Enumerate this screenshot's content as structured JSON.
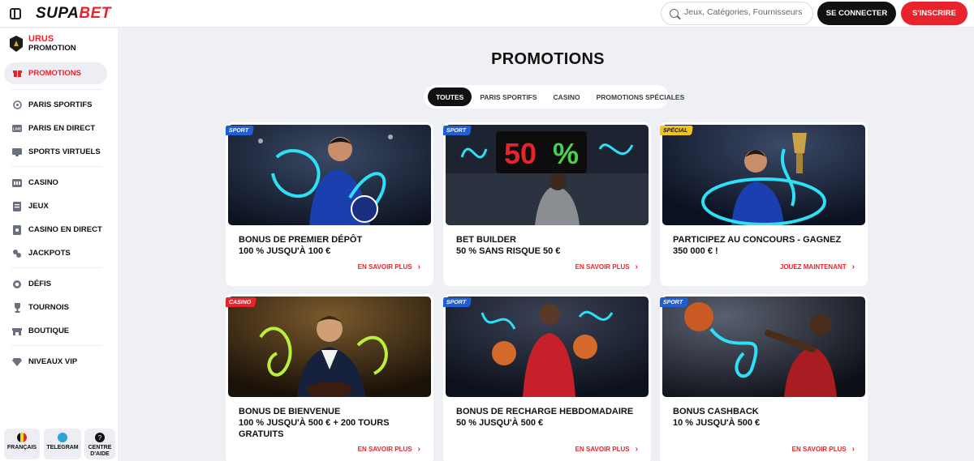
{
  "header": {
    "logo_part1": "SUPA",
    "logo_part2": "BET",
    "search_placeholder": "Jeux, Catégories, Fournisseurs",
    "login_label": "SE CONNECTER",
    "signup_label": "S'INSCRIRE"
  },
  "sidebar": {
    "brand_line1": "URUS",
    "brand_line2": "PROMOTION",
    "items": [
      {
        "label": "PROMOTIONS",
        "icon": "gift-icon",
        "active": true
      },
      {
        "label": "PARIS SPORTIFS",
        "icon": "sports-icon"
      },
      {
        "label": "PARIS EN DIRECT",
        "icon": "live-icon"
      },
      {
        "label": "SPORTS VIRTUELS",
        "icon": "virtual-sports-icon"
      },
      {
        "label": "CASINO",
        "icon": "casino-icon"
      },
      {
        "label": "JEUX",
        "icon": "games-icon"
      },
      {
        "label": "CASINO EN DIRECT",
        "icon": "live-casino-icon"
      },
      {
        "label": "JACKPOTS",
        "icon": "jackpot-icon"
      },
      {
        "label": "DÉFIS",
        "icon": "challenge-icon"
      },
      {
        "label": "TOURNOIS",
        "icon": "trophy-icon"
      },
      {
        "label": "BOUTIQUE",
        "icon": "shop-icon"
      },
      {
        "label": "NIVEAUX VIP",
        "icon": "diamond-icon"
      }
    ],
    "bottom": {
      "language": "FRANÇAIS",
      "telegram": "TELEGRAM",
      "help": "CENTRE D'AIDE"
    }
  },
  "main": {
    "title": "PROMOTIONS",
    "tabs": [
      "TOUTES",
      "PARIS SPORTIFS",
      "CASINO",
      "PROMOTIONS SPÉCIALES"
    ],
    "cards": [
      {
        "tag": "SPORT",
        "title1": "BONUS DE PREMIER DÉPÔT",
        "title2": "100 % JUSQU'À 100 €",
        "title3": "",
        "cta": "EN SAVOIR PLUS"
      },
      {
        "tag": "SPORT",
        "title1": "BET BUILDER",
        "title2": "50 % SANS RISQUE 50 €",
        "title3": "",
        "cta": "EN SAVOIR PLUS"
      },
      {
        "tag": "SPÉCIAL",
        "title1": "PARTICIPEZ AU CONCOURS - GAGNEZ",
        "title2": "350 000 € !",
        "title3": "",
        "cta": "JOUEZ MAINTENANT"
      },
      {
        "tag": "CASINO",
        "title1": "BONUS DE BIENVENUE",
        "title2": "100 % JUSQU'À 500 € + 200 TOURS",
        "title3": "GRATUITS",
        "cta": "EN SAVOIR PLUS"
      },
      {
        "tag": "SPORT",
        "title1": "BONUS DE RECHARGE HEBDOMADAIRE",
        "title2": "50 % JUSQU'À 500 €",
        "title3": "",
        "cta": "EN SAVOIR PLUS"
      },
      {
        "tag": "SPORT",
        "title1": "BONUS CASHBACK",
        "title2": "10 % JUSQU'À 500 €",
        "title3": "",
        "cta": "EN SAVOIR PLUS"
      }
    ],
    "scoreboard_text": "50%"
  },
  "colors": {
    "brand_red": "#e8232b",
    "sport_blue": "#1f5fd6",
    "special_yellow": "#f2c418",
    "dark": "#111111"
  }
}
